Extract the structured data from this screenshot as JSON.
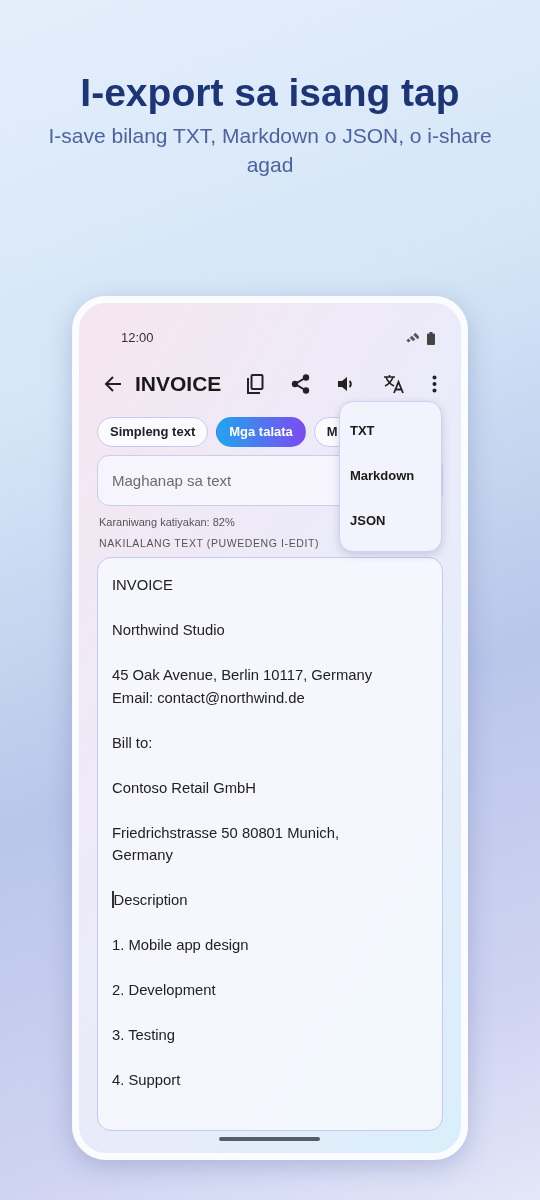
{
  "headline": {
    "title": "I-export sa isang tap",
    "subtitle": "I-save bilang TXT, Markdown o JSON, o i-share agad"
  },
  "status_bar": {
    "time": "12:00"
  },
  "app_bar": {
    "title": "INVOICE"
  },
  "chips": [
    {
      "label": "Simpleng text",
      "selected": false
    },
    {
      "label": "Mga talata",
      "selected": true
    },
    {
      "label": "M",
      "selected": false
    }
  ],
  "search": {
    "placeholder": "Maghanap sa text"
  },
  "confidence": "Karaniwang katiyakan: 82%",
  "section_label": "NAKILALANG TEXT (PUWEDENG I-EDIT)",
  "paragraphs": [
    {
      "lines": [
        "INVOICE"
      ],
      "cursor": false
    },
    {
      "lines": [
        "Northwind Studio"
      ],
      "cursor": false
    },
    {
      "lines": [
        "45 Oak Avenue, Berlin 10117, Germany",
        "Email: contact@northwind.de"
      ],
      "cursor": false
    },
    {
      "lines": [
        "Bill to:"
      ],
      "cursor": false
    },
    {
      "lines": [
        "Contoso Retail GmbH"
      ],
      "cursor": false
    },
    {
      "lines": [
        "Friedrichstrasse 50 80801 Munich, Germany"
      ],
      "cursor": false
    },
    {
      "lines": [
        "Description"
      ],
      "cursor": true
    },
    {
      "lines": [
        "1. Mobile app design"
      ],
      "cursor": false
    },
    {
      "lines": [
        "2. Development"
      ],
      "cursor": false
    },
    {
      "lines": [
        "3. Testing"
      ],
      "cursor": false
    },
    {
      "lines": [
        "4. Support"
      ],
      "cursor": false
    }
  ],
  "export_menu": {
    "items": [
      "TXT",
      "Markdown",
      "JSON"
    ]
  }
}
